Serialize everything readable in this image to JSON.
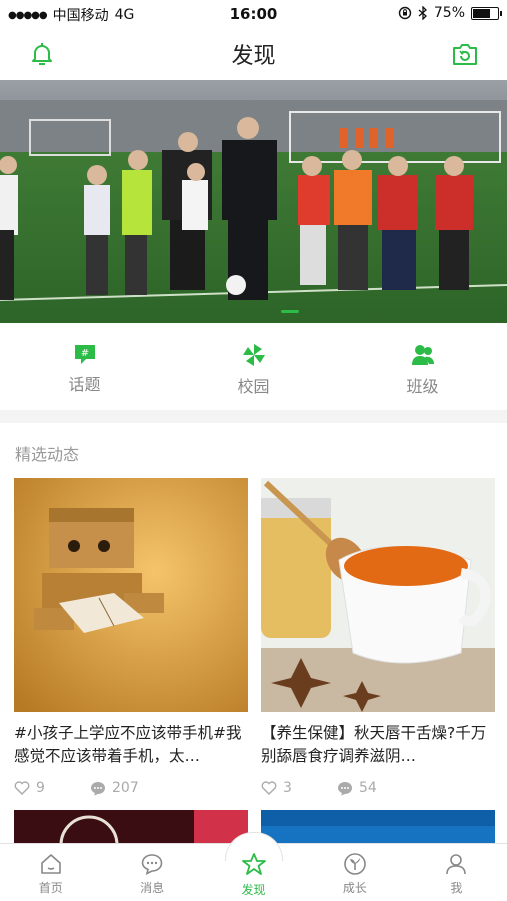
{
  "status_bar": {
    "carrier": "中国移动",
    "network": "4G",
    "time": "16:00",
    "battery": "75%",
    "battery_level": 0.75
  },
  "header": {
    "title": "发现",
    "left_icon": "bell-icon",
    "right_icon": "camera-icon"
  },
  "banner": {
    "image_subject": "youth soccer team on field",
    "active_slide": 2
  },
  "quick_nav": [
    {
      "label": "话题",
      "icon": "topic-hash-icon"
    },
    {
      "label": "校园",
      "icon": "campus-pinwheel-icon"
    },
    {
      "label": "班级",
      "icon": "class-people-icon"
    }
  ],
  "featured": {
    "section_title": "精选动态",
    "cards": [
      {
        "caption": "#小孩子上学应不应该带手机#我感觉不应该带着手机，太…",
        "likes": "9",
        "comments": "207",
        "image_subject": "cardboard box robot reading book"
      },
      {
        "caption": "【养生保健】秋天唇干舌燥?千万别舔唇食疗调养滋阴…",
        "likes": "3",
        "comments": "54",
        "image_subject": "cup of honey tea with honey dipper"
      }
    ]
  },
  "tab_bar": [
    {
      "label": "首页",
      "icon": "home-icon",
      "active": false
    },
    {
      "label": "消息",
      "icon": "message-icon",
      "active": false
    },
    {
      "label": "发现",
      "icon": "discover-icon",
      "active": true
    },
    {
      "label": "成长",
      "icon": "growth-sprout-icon",
      "active": false
    },
    {
      "label": "我",
      "icon": "profile-icon",
      "active": false
    }
  ],
  "colors": {
    "accent": "#2dbb48",
    "text_secondary": "#888888"
  }
}
